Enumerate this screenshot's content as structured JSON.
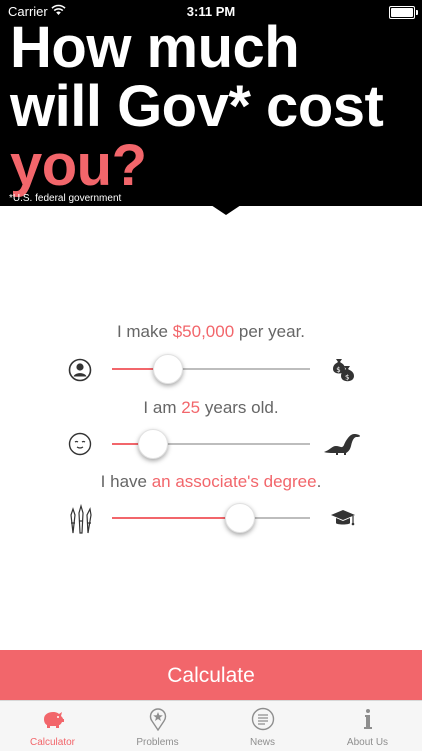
{
  "status_bar": {
    "carrier": "Carrier",
    "time": "3:11 PM"
  },
  "header": {
    "headline_line1": "How much",
    "headline_line2": "will Gov* cost",
    "headline_line3": "you?",
    "footnote": "*U.S. federal government"
  },
  "calculator": {
    "income": {
      "prefix": "I make ",
      "value": "$50,000",
      "suffix": " per year.",
      "slider_position": 0.28,
      "left_icon": "person-icon",
      "right_icon": "money-bags-icon"
    },
    "age": {
      "prefix": "I am ",
      "value": "25",
      "suffix": " years old.",
      "slider_position": 0.2,
      "left_icon": "baby-face-icon",
      "right_icon": "dinosaur-icon"
    },
    "education": {
      "prefix": "I have ",
      "value": "an associate's degree",
      "suffix": ".",
      "slider_position": 0.64,
      "left_icon": "crayons-icon",
      "right_icon": "graduation-cap-icon"
    },
    "calculate_label": "Calculate"
  },
  "tabbar": {
    "tabs": [
      {
        "label": "Calculator",
        "icon": "piggy-bank-icon",
        "active": true
      },
      {
        "label": "Problems",
        "icon": "map-pin-icon",
        "active": false
      },
      {
        "label": "News",
        "icon": "newspaper-icon",
        "active": false
      },
      {
        "label": "About Us",
        "icon": "info-icon",
        "active": false
      }
    ]
  },
  "colors": {
    "accent": "#f2666b",
    "header_bg": "#000000",
    "text_gray": "#666666"
  }
}
